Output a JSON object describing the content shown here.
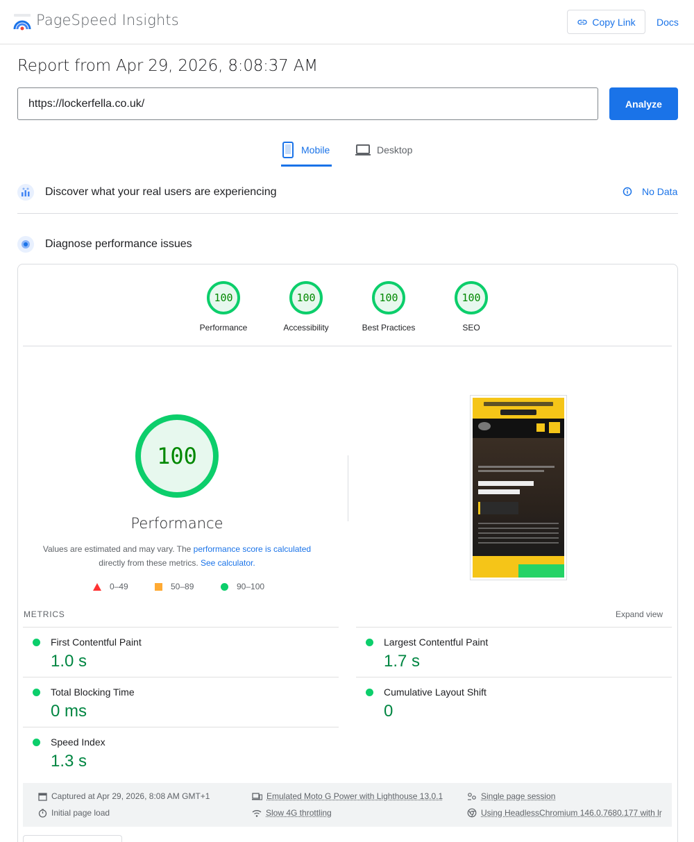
{
  "header": {
    "app_title": "PageSpeed Insights",
    "copy_link_label": "Copy Link",
    "docs_label": "Docs",
    "brand_color": "#1a73e8"
  },
  "report": {
    "title": "Report from Apr 29, 2026, 8:08:37 AM"
  },
  "search": {
    "url_value": "https://lockerfella.co.uk/",
    "analyze_label": "Analyze"
  },
  "tabs": [
    {
      "label": "Mobile",
      "icon": "smartphone-icon",
      "active": true
    },
    {
      "label": "Desktop",
      "icon": "laptop-icon",
      "active": false
    }
  ],
  "sections": {
    "real_users": {
      "title": "Discover what your real users are experiencing",
      "status": "No Data"
    },
    "diagnose": {
      "title": "Diagnose performance issues"
    }
  },
  "scores": [
    {
      "label": "Performance",
      "value": "100"
    },
    {
      "label": "Accessibility",
      "value": "100"
    },
    {
      "label": "Best Practices",
      "value": "100"
    },
    {
      "label": "SEO",
      "value": "100"
    }
  ],
  "performance": {
    "score": "100",
    "label": "Performance",
    "note_prefix": "Values are estimated and may vary. The ",
    "note_link1": "performance score is calculated",
    "note_mid": "directly from these metrics. ",
    "note_link2": "See calculator.",
    "legend": [
      {
        "range": "0–49",
        "color": "#ff3333",
        "shape": "triangle"
      },
      {
        "range": "50–89",
        "color": "#ffaa33",
        "shape": "square"
      },
      {
        "range": "90–100",
        "color": "#0cce6b",
        "shape": "circle"
      }
    ],
    "good_color": "#0cce6b"
  },
  "metrics": {
    "title": "METRICS",
    "expand_label": "Expand view",
    "items": [
      {
        "name": "First Contentful Paint",
        "value": "1.0 s"
      },
      {
        "name": "Largest Contentful Paint",
        "value": "1.7 s"
      },
      {
        "name": "Total Blocking Time",
        "value": "0 ms"
      },
      {
        "name": "Cumulative Layout Shift",
        "value": "0"
      },
      {
        "name": "Speed Index",
        "value": "1.3 s"
      }
    ]
  },
  "run_info": {
    "captured": "Captured at Apr 29, 2026, 8:08 AM GMT+1",
    "load": "Initial page load",
    "device": "Emulated Moto G Power with Lighthouse 13.0.1",
    "throttling": "Slow 4G throttling",
    "session": "Single page session",
    "browser": "Using HeadlessChromium 146.0.7680.177 with lr"
  }
}
